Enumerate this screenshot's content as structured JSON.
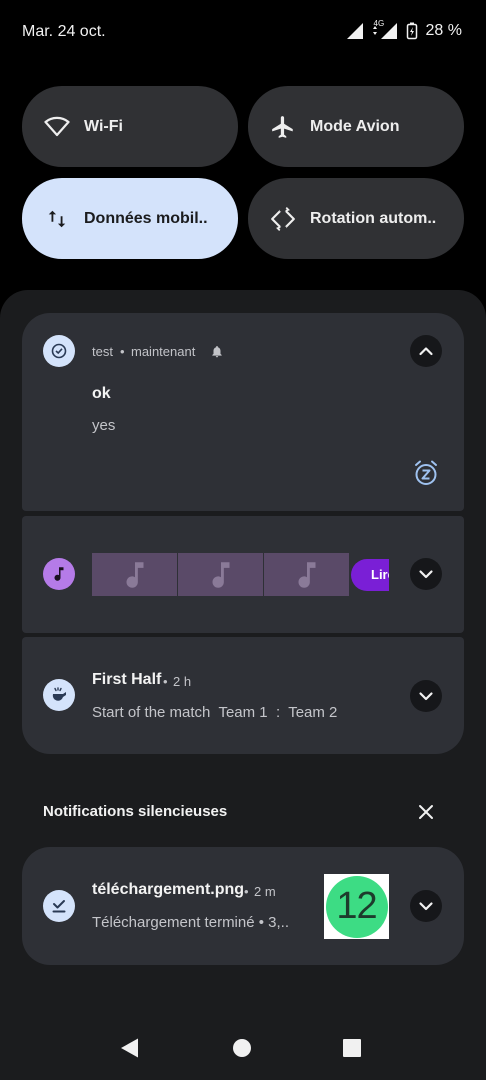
{
  "status_bar": {
    "date": "Mar. 24 oct.",
    "network_label": "4G",
    "battery": "28 %"
  },
  "quick_tiles": [
    {
      "label": "Wi-Fi",
      "icon": "wifi-icon",
      "active": false
    },
    {
      "label": "Mode Avion",
      "icon": "airplane-icon",
      "active": false
    },
    {
      "label": "Données mobil..",
      "icon": "mobile-data-icon",
      "active": true
    },
    {
      "label": "Rotation autom..",
      "icon": "auto-rotate-icon",
      "active": false
    }
  ],
  "notifications": {
    "test": {
      "app": "test",
      "time": "maintenant",
      "title": "ok",
      "body": "yes",
      "icons": [
        "check-circle-icon",
        "bell-icon",
        "collapse-chevron-icon",
        "snooze-icon"
      ]
    },
    "media": {
      "pill_label": "Lire",
      "icons": [
        "music-note-icon",
        "expand-chevron-icon"
      ]
    },
    "match": {
      "title": "First Half",
      "time": "2 h",
      "body": "Start of the match  Team 1  :  Team 2",
      "icons": [
        "whistle-icon",
        "expand-chevron-icon"
      ]
    }
  },
  "silent_section": {
    "label": "Notifications silencieuses",
    "close_icon": "close-icon"
  },
  "download_notification": {
    "title": "téléchargement.png",
    "time": "2 m",
    "body": "Téléchargement terminé • 3,..",
    "thumbnail_text": "12",
    "icons": [
      "download-done-icon",
      "expand-chevron-icon"
    ]
  },
  "nav_bar": {
    "icons": [
      "back-icon",
      "home-icon",
      "recents-icon"
    ]
  },
  "colors": {
    "background": "#000000",
    "shade": "#1b1c1e",
    "card": "#2e3036",
    "tile": "#303134",
    "tile_active": "#d4e3fb",
    "media_pill": "#7a1fd6",
    "android_green": "#3ddc84"
  }
}
